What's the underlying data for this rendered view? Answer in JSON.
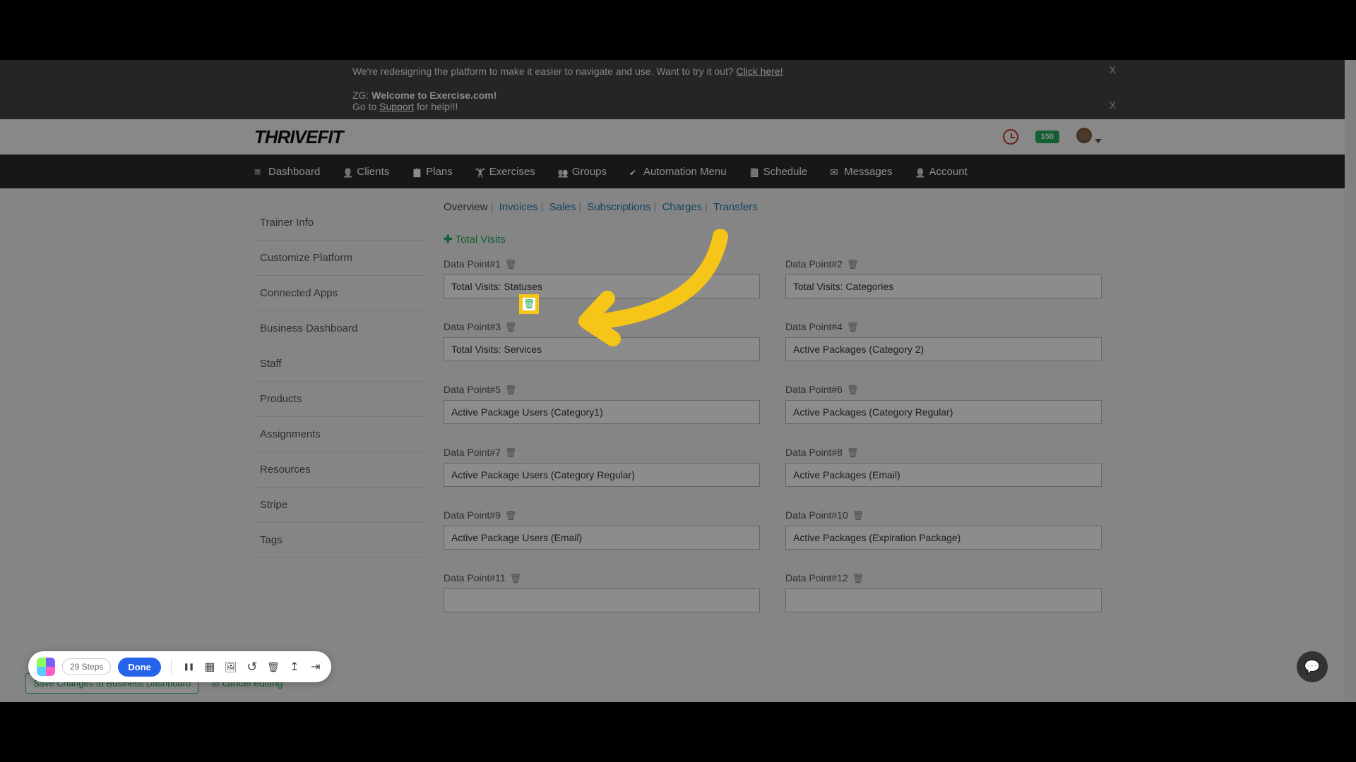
{
  "banner1": {
    "text_pre": "We're redesigning the platform to make it easier to navigate and use. Want to try it out? ",
    "link": "Click here!"
  },
  "banner2": {
    "prefix": "ZG: ",
    "bold": "Welcome to Exercise.com!",
    "line2_pre": "Go to ",
    "line2_link": "Support",
    "line2_post": " for help!!!"
  },
  "brand": "THRIVEFIT",
  "header_badge": "150",
  "nav": [
    {
      "label": "Dashboard"
    },
    {
      "label": "Clients"
    },
    {
      "label": "Plans"
    },
    {
      "label": "Exercises"
    },
    {
      "label": "Groups"
    },
    {
      "label": "Automation Menu"
    },
    {
      "label": "Schedule"
    },
    {
      "label": "Messages"
    },
    {
      "label": "Account"
    }
  ],
  "sidebar": {
    "items": [
      "Trainer Info",
      "Customize Platform",
      "Connected Apps",
      "Business Dashboard",
      "Staff",
      "Products",
      "Assignments",
      "Resources",
      "Stripe",
      "Tags"
    ]
  },
  "subnav": [
    "Overview",
    "Invoices",
    "Sales",
    "Subscriptions",
    "Charges",
    "Transfers"
  ],
  "add_label": "Total Visits",
  "datapoints": [
    {
      "label": "Data Point#1",
      "value": "Total Visits: Statuses"
    },
    {
      "label": "Data Point#2",
      "value": "Total Visits: Categories"
    },
    {
      "label": "Data Point#3",
      "value": "Total Visits: Services"
    },
    {
      "label": "Data Point#4",
      "value": "Active Packages (Category 2)"
    },
    {
      "label": "Data Point#5",
      "value": "Active Package Users (Category1)"
    },
    {
      "label": "Data Point#6",
      "value": "Active Packages (Category Regular)"
    },
    {
      "label": "Data Point#7",
      "value": "Active Package Users (Category Regular)"
    },
    {
      "label": "Data Point#8",
      "value": "Active Packages (Email)"
    },
    {
      "label": "Data Point#9",
      "value": "Active Package Users (Email)"
    },
    {
      "label": "Data Point#10",
      "value": "Active Packages (Expiration Package)"
    },
    {
      "label": "Data Point#11",
      "value": ""
    },
    {
      "label": "Data Point#12",
      "value": ""
    }
  ],
  "savebar": {
    "save": "Save Changes to Business Dashboard",
    "cancel_icon": "⊘",
    "cancel": "cancel editing"
  },
  "tutbar": {
    "steps": "29 Steps",
    "done": "Done"
  }
}
